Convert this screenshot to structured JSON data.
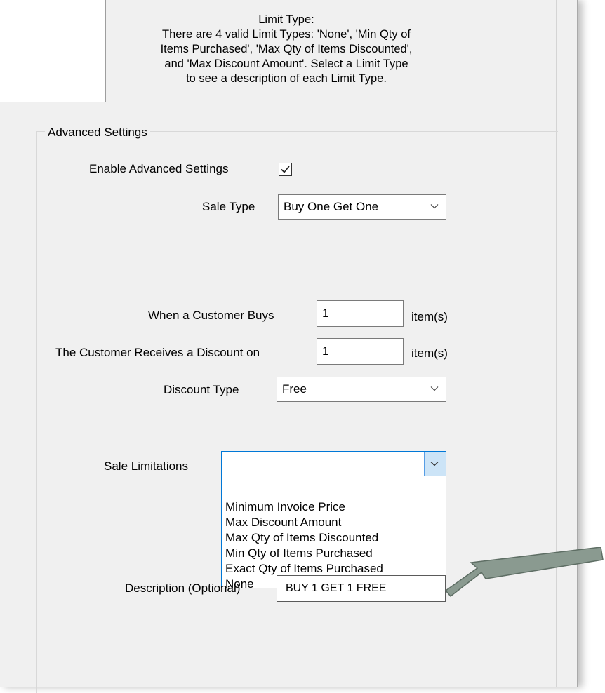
{
  "limit_help": {
    "title": "Limit Type:",
    "lines": [
      "There are 4 valid Limit Types: 'None', 'Min Qty of",
      "Items Purchased', 'Max Qty of Items Discounted',",
      "and 'Max Discount Amount'. Select a Limit Type",
      "to see a description of each Limit Type."
    ]
  },
  "advanced": {
    "group_title": "Advanced Settings",
    "enable_label": "Enable Advanced Settings",
    "enable_checked": true,
    "sale_type_label": "Sale Type",
    "sale_type_value": "Buy One Get One",
    "buys_label": "When a Customer Buys",
    "buys_value": "1",
    "buys_unit": "item(s)",
    "receives_label": "The Customer Receives a Discount on",
    "receives_value": "1",
    "receives_unit": "item(s)",
    "discount_type_label": "Discount Type",
    "discount_type_value": "Free",
    "sale_limitations_label": "Sale Limitations",
    "sale_limitations_value": "",
    "sale_limitations_options": [
      "Minimum Invoice Price",
      "Max Discount Amount",
      "Max Qty of Items Discounted",
      "Min Qty of Items Purchased",
      "Exact Qty of Items Purchased",
      "None"
    ],
    "description_label": "Description (Optional)",
    "description_value": "BUY 1 GET 1 FREE"
  },
  "icons": {
    "dropdown_arrow": "chevron-down-icon",
    "checkbox_check": "check-icon",
    "callout_arrow": "pointer-arrow-icon"
  },
  "colors": {
    "accent": "#0078d7",
    "callout_arrow": "#8a9a90"
  }
}
